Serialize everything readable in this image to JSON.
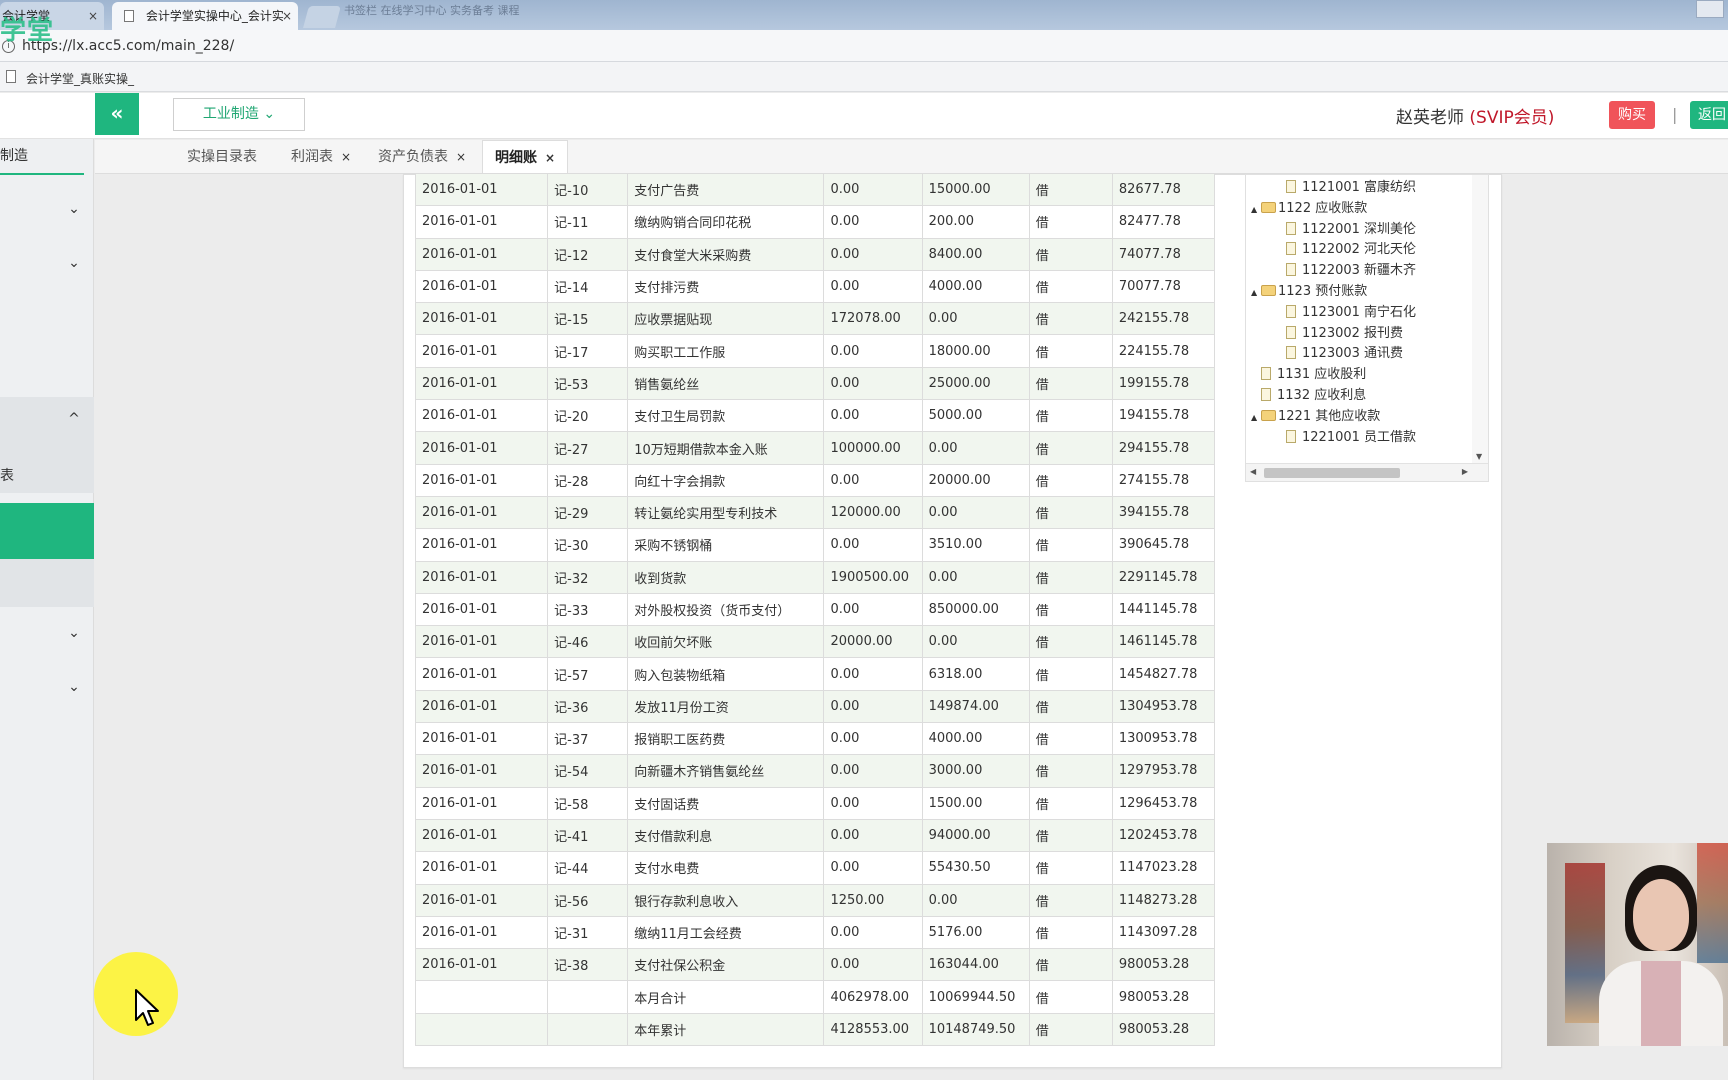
{
  "browser": {
    "tab_inactive": "会计学堂",
    "tab_active": "会计学堂实操中心_会计实",
    "url": "https://lx.acc5.com/main_228/",
    "bookmark": "会计学堂_真账实操_",
    "blurred_bookmarks": "  书签栏    在线学习中心    实务备考    课程"
  },
  "brand": {
    "logo_text": "学堂"
  },
  "header": {
    "collapse_icon": "«",
    "industry": "工业制造",
    "teacher": "赵英老师",
    "vip": "(SVIP会员)",
    "buy": "购买",
    "separator": "|",
    "back": "返回"
  },
  "sidebar": {
    "title": "制造",
    "label": "表"
  },
  "tabs": [
    {
      "label": "实操目录表",
      "closable": false
    },
    {
      "label": "利润表",
      "closable": true
    },
    {
      "label": "资产负债表",
      "closable": true
    },
    {
      "label": "明细账",
      "closable": true,
      "active": true
    }
  ],
  "ledger": {
    "rows": [
      [
        "2016-01-01",
        "记-10",
        "支付广告费",
        "0.00",
        "15000.00",
        "借",
        "82677.78"
      ],
      [
        "2016-01-01",
        "记-11",
        "缴纳购销合同印花税",
        "0.00",
        "200.00",
        "借",
        "82477.78"
      ],
      [
        "2016-01-01",
        "记-12",
        "支付食堂大米采购费",
        "0.00",
        "8400.00",
        "借",
        "74077.78"
      ],
      [
        "2016-01-01",
        "记-14",
        "支付排污费",
        "0.00",
        "4000.00",
        "借",
        "70077.78"
      ],
      [
        "2016-01-01",
        "记-15",
        "应收票据贴现",
        "172078.00",
        "0.00",
        "借",
        "242155.78"
      ],
      [
        "2016-01-01",
        "记-17",
        "购买职工工作服",
        "0.00",
        "18000.00",
        "借",
        "224155.78"
      ],
      [
        "2016-01-01",
        "记-53",
        "销售氨纶丝",
        "0.00",
        "25000.00",
        "借",
        "199155.78"
      ],
      [
        "2016-01-01",
        "记-20",
        "支付卫生局罚款",
        "0.00",
        "5000.00",
        "借",
        "194155.78"
      ],
      [
        "2016-01-01",
        "记-27",
        "10万短期借款本金入账",
        "100000.00",
        "0.00",
        "借",
        "294155.78"
      ],
      [
        "2016-01-01",
        "记-28",
        "向红十字会捐款",
        "0.00",
        "20000.00",
        "借",
        "274155.78"
      ],
      [
        "2016-01-01",
        "记-29",
        "转让氨纶实用型专利技术",
        "120000.00",
        "0.00",
        "借",
        "394155.78"
      ],
      [
        "2016-01-01",
        "记-30",
        "采购不锈钢桶",
        "0.00",
        "3510.00",
        "借",
        "390645.78"
      ],
      [
        "2016-01-01",
        "记-32",
        "收到货款",
        "1900500.00",
        "0.00",
        "借",
        "2291145.78"
      ],
      [
        "2016-01-01",
        "记-33",
        "对外股权投资（货币支付）",
        "0.00",
        "850000.00",
        "借",
        "1441145.78"
      ],
      [
        "2016-01-01",
        "记-46",
        "收回前欠坏账",
        "20000.00",
        "0.00",
        "借",
        "1461145.78"
      ],
      [
        "2016-01-01",
        "记-57",
        "购入包装物纸箱",
        "0.00",
        "6318.00",
        "借",
        "1454827.78"
      ],
      [
        "2016-01-01",
        "记-36",
        "发放11月份工资",
        "0.00",
        "149874.00",
        "借",
        "1304953.78"
      ],
      [
        "2016-01-01",
        "记-37",
        "报销职工医药费",
        "0.00",
        "4000.00",
        "借",
        "1300953.78"
      ],
      [
        "2016-01-01",
        "记-54",
        "向新疆木齐销售氨纶丝",
        "0.00",
        "3000.00",
        "借",
        "1297953.78"
      ],
      [
        "2016-01-01",
        "记-58",
        "支付固话费",
        "0.00",
        "1500.00",
        "借",
        "1296453.78"
      ],
      [
        "2016-01-01",
        "记-41",
        "支付借款利息",
        "0.00",
        "94000.00",
        "借",
        "1202453.78"
      ],
      [
        "2016-01-01",
        "记-44",
        "支付水电费",
        "0.00",
        "55430.50",
        "借",
        "1147023.28"
      ],
      [
        "2016-01-01",
        "记-56",
        "银行存款利息收入",
        "1250.00",
        "0.00",
        "借",
        "1148273.28"
      ],
      [
        "2016-01-01",
        "记-31",
        "缴纳11月工会经费",
        "0.00",
        "5176.00",
        "借",
        "1143097.28"
      ],
      [
        "2016-01-01",
        "记-38",
        "支付社保公积金",
        "0.00",
        "163044.00",
        "借",
        "980053.28"
      ],
      [
        "",
        "",
        "本月合计",
        "4062978.00",
        "10069944.50",
        "借",
        "980053.28"
      ],
      [
        "",
        "",
        "本年累计",
        "4128553.00",
        "10148749.50",
        "借",
        "980053.28"
      ]
    ]
  },
  "tree": {
    "items": [
      {
        "label": "1121001 富康纺织",
        "level": 2,
        "type": "file"
      },
      {
        "label": "1122 应收账款",
        "level": 1,
        "type": "folder",
        "expanded": true
      },
      {
        "label": "1122001 深圳美伦",
        "level": 2,
        "type": "file"
      },
      {
        "label": "1122002 河北天伦",
        "level": 2,
        "type": "file"
      },
      {
        "label": "1122003 新疆木齐",
        "level": 2,
        "type": "file"
      },
      {
        "label": "1123 预付账款",
        "level": 1,
        "type": "folder",
        "expanded": true
      },
      {
        "label": "1123001 南宁石化",
        "level": 2,
        "type": "file"
      },
      {
        "label": "1123002 报刊费",
        "level": 2,
        "type": "file"
      },
      {
        "label": "1123003 通讯费",
        "level": 2,
        "type": "file"
      },
      {
        "label": "1131 应收股利",
        "level": 1,
        "type": "file"
      },
      {
        "label": "1132 应收利息",
        "level": 1,
        "type": "file"
      },
      {
        "label": "1221 其他应收款",
        "level": 1,
        "type": "folder",
        "expanded": true
      },
      {
        "label": "1221001 员工借款",
        "level": 2,
        "type": "file"
      }
    ]
  },
  "icons": {
    "close": "×",
    "chevron_down": "⌄",
    "chevron_up": "^",
    "tree_expanded": "▲",
    "scroll_down": "▼",
    "scroll_left": "◀",
    "scroll_right": "▶"
  }
}
